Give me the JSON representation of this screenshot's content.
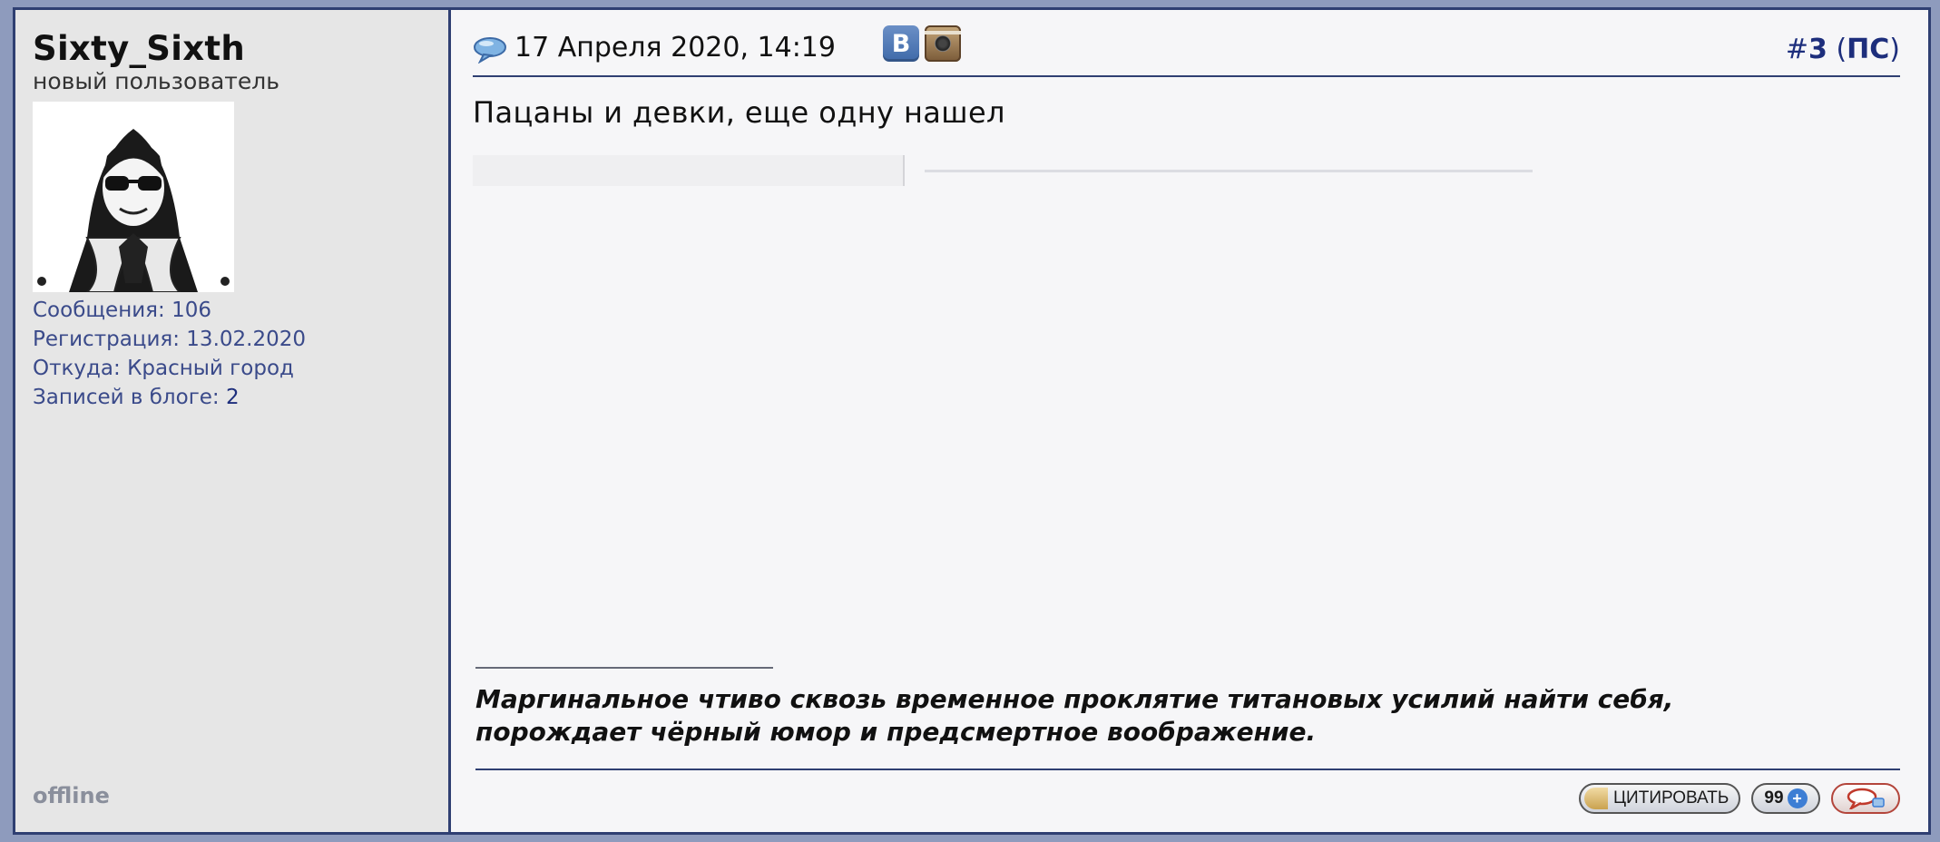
{
  "user": {
    "name": "Sixty_Sixth",
    "title": "новый пользователь",
    "status": "offline",
    "stats": {
      "posts_label": "Сообщения: ",
      "posts_value": "106",
      "reg_label": "Регистрация: ",
      "reg_value": "13.02.2020",
      "from_label": "Откуда: ",
      "from_value": "Красный город",
      "blog_label": "Записей в блоге: ",
      "blog_value": "2"
    }
  },
  "post": {
    "date": "17 Апреля 2020, 14:19",
    "number_prefix": "#",
    "number": "3",
    "ps_open": " (",
    "ps_link": "ПС",
    "ps_close": ")",
    "message": "Пацаны и девки, еще одну нашел",
    "signature": "Маргинальное чтиво сквозь временное проклятие титановых усилий найти себя, порождает чёрный юмор и предсмертное воображение."
  },
  "social": {
    "vk_label": "B"
  },
  "actions": {
    "quote_label": "ЦИТИРОВАТЬ",
    "multiquote_label": "99",
    "multiquote_plus": "+"
  },
  "colors": {
    "frame": "#2f3f72",
    "link": "#1d2e7c",
    "background": "#8e9bbd"
  }
}
